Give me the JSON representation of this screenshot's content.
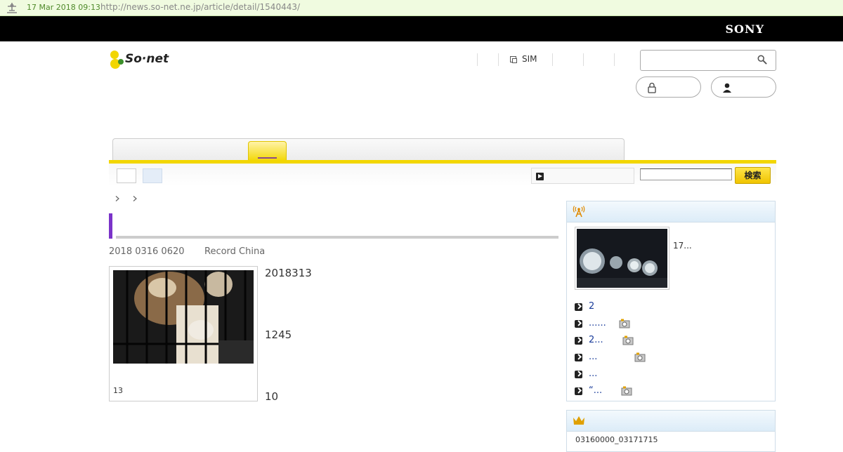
{
  "archive": {
    "date": "17 Mar 2018 09:13",
    "url": "http://news.so-net.ne.jp/article/detail/1540443/"
  },
  "brand": {
    "sony": "SONY",
    "logo": "So·net"
  },
  "topnav": {
    "sim_label": "SIM"
  },
  "search": {
    "button_label": "検索"
  },
  "article": {
    "date": "2018 0316 0620",
    "source": "Record China",
    "photo_caption": "13",
    "paragraphs": [
      "2018313",
      "1245",
      "10"
    ]
  },
  "sidebar": {
    "news": {
      "thumb_caption": "17...",
      "items": [
        {
          "label": "2",
          "camera": false
        },
        {
          "label": "......",
          "camera": true
        },
        {
          "label": "2...",
          "camera": true
        },
        {
          "label": "...",
          "camera": true
        },
        {
          "label": "...",
          "camera": false
        },
        {
          "label": "“...",
          "camera": true
        }
      ]
    },
    "ranking": {
      "text": "03160000_03171715"
    }
  },
  "colors": {
    "accent_yellow": "#f2d600",
    "title_purple": "#7b33c9",
    "link_blue": "#1a3c9a"
  }
}
